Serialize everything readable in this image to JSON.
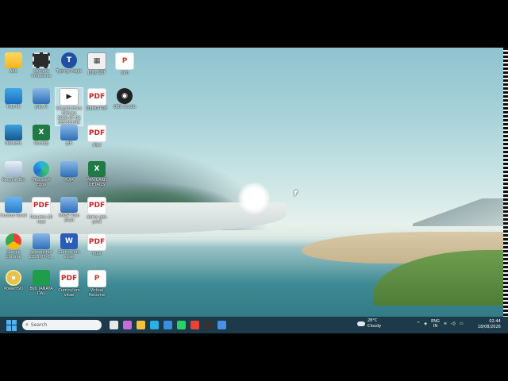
{
  "desktop": {
    "icons": [
      {
        "label": "ABC",
        "glyph": "",
        "cls": "g-folder",
        "icon": "folder-icon"
      },
      {
        "label": "Camera Initiatives",
        "glyph": "",
        "cls": "g-film",
        "icon": "film-icon"
      },
      {
        "label": "Typing Magic",
        "glyph": "T",
        "cls": "g-circle",
        "icon": "typing-app-icon"
      },
      {
        "label": "Jolly GST",
        "glyph": "▦",
        "cls": "g-calc",
        "icon": "calculator-icon"
      },
      {
        "label": "ram",
        "glyph": "P",
        "cls": "g-ppt",
        "icon": "presentation-icon"
      },
      {
        "label": "This PC",
        "glyph": "",
        "cls": "g-monitor",
        "icon": "computer-icon"
      },
      {
        "label": "Jolly G",
        "glyph": "",
        "cls": "g-img",
        "icon": "image-file-icon"
      },
      {
        "label": "Wondershare Filmora 2026-07-01 082321PM",
        "glyph": "▶",
        "cls": "g-vid",
        "icon": "video-file-icon"
      },
      {
        "label": "DEMO PDF",
        "glyph": "PDF",
        "cls": "g-red",
        "icon": "pdf-icon"
      },
      {
        "label": "OBS Studio",
        "glyph": "◉",
        "cls": "g-obs",
        "icon": "obs-icon"
      },
      {
        "label": "Network",
        "glyph": "",
        "cls": "g-net",
        "icon": "network-icon"
      },
      {
        "label": "Mocktp",
        "glyph": "X",
        "cls": "g-xls",
        "icon": "excel-icon"
      },
      {
        "label": "gift",
        "glyph": "",
        "cls": "g-img",
        "icon": "image-file-icon"
      },
      {
        "label": "slips",
        "glyph": "PDF",
        "cls": "g-red",
        "icon": "pdf-icon"
      },
      {
        "label": "Recycle Bin",
        "glyph": "",
        "cls": "g-bin",
        "icon": "recycle-bin-icon"
      },
      {
        "label": "Microsoft Edge",
        "glyph": "",
        "cls": "g-edge",
        "icon": "edge-icon"
      },
      {
        "label": "PUJA",
        "glyph": "",
        "cls": "g-img",
        "icon": "image-file-icon"
      },
      {
        "label": "PAN CARD DETAILS",
        "glyph": "X",
        "cls": "g-xls",
        "icon": "excel-icon"
      },
      {
        "label": "Control Panel",
        "glyph": "",
        "cls": "g-cp",
        "icon": "control-panel-icon"
      },
      {
        "label": "Resume-10 new",
        "glyph": "PDF",
        "cls": "g-red",
        "icon": "pdf-icon"
      },
      {
        "label": "MKSP Plan 2024",
        "glyph": "",
        "cls": "g-img",
        "icon": "image-file-icon"
      },
      {
        "label": "demo gen print",
        "glyph": "PDF",
        "cls": "g-red",
        "icon": "pdf-icon"
      },
      {
        "label": "Google Chrome",
        "glyph": "",
        "cls": "g-chrome",
        "icon": "chrome-icon"
      },
      {
        "label": "Screenshot 2026-07-0...",
        "glyph": "",
        "cls": "g-img",
        "icon": "image-file-icon"
      },
      {
        "label": "Curriculum vitae",
        "glyph": "W",
        "cls": "g-word",
        "icon": "word-icon"
      },
      {
        "label": "mail",
        "glyph": "PDF",
        "cls": "g-red",
        "icon": "pdf-icon"
      },
      {
        "label": "PowerISO",
        "glyph": "",
        "cls": "g-cd",
        "icon": "poweriso-icon"
      },
      {
        "label": "BIJU JANATA DAL",
        "glyph": "",
        "cls": "g-green",
        "icon": "image-file-icon"
      },
      {
        "label": "Curriculum vitae",
        "glyph": "PDF",
        "cls": "g-red",
        "icon": "pdf-icon"
      },
      {
        "label": "Virtual Resume",
        "glyph": "P",
        "cls": "g-ppt",
        "icon": "presentation-icon"
      }
    ]
  },
  "taskbar": {
    "search_placeholder": "Search",
    "apps": [
      {
        "icon": "task-view-icon",
        "color": "#e8e8e8"
      },
      {
        "icon": "copilot-icon",
        "color": "#c86bd6"
      },
      {
        "icon": "file-explorer-icon",
        "color": "#f3c23a"
      },
      {
        "icon": "edge-icon",
        "color": "#2ab1e3"
      },
      {
        "icon": "store-icon",
        "color": "#3b8de0"
      },
      {
        "icon": "whatsapp-icon",
        "color": "#25d366"
      },
      {
        "icon": "chrome-icon",
        "color": "#ea4335"
      },
      {
        "icon": "obs-icon",
        "color": "#333333"
      },
      {
        "icon": "app-icon",
        "color": "#4a90e2"
      }
    ],
    "weather": {
      "temp": "28°C",
      "condition": "Cloudy"
    },
    "tray": {
      "chevron": "^",
      "lang_top": "ENG",
      "lang_bottom": "IN",
      "wifi": "wifi",
      "sound": "sound",
      "battery": "battery"
    },
    "clock": {
      "time": "02:44",
      "date": "18/08/2026"
    }
  }
}
